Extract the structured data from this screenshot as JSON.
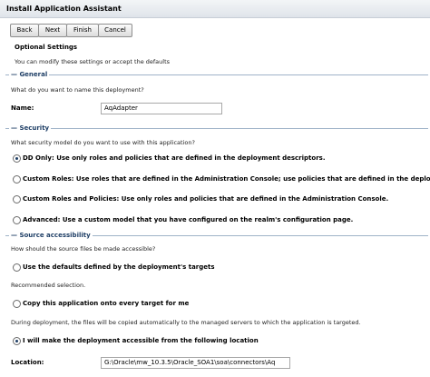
{
  "window": {
    "title": "Install Application Assistant"
  },
  "toolbar": {
    "back": "Back",
    "next": "Next",
    "finish": "Finish",
    "cancel": "Cancel"
  },
  "optional": {
    "title": "Optional Settings",
    "desc": "You can modify these settings or accept the defaults"
  },
  "general": {
    "title": "General",
    "question": "What do you want to name this deployment?",
    "name_label": "Name:",
    "name_value": "AqAdapter"
  },
  "security": {
    "title": "Security",
    "question": "What security model do you want to use with this application?",
    "options": [
      "DD Only: Use only roles and policies that are defined in the deployment descriptors.",
      "Custom Roles: Use roles that are defined in the Administration Console; use policies that are defined in the deployment descripto",
      "Custom Roles and Policies: Use only roles and policies that are defined in the Administration Console.",
      "Advanced: Use a custom model that you have configured on the realm's configuration page."
    ],
    "selected_index": 0
  },
  "source": {
    "title": "Source accessibility",
    "question": "How should the source files be made accessible?",
    "opt1": "Use the defaults defined by the deployment's targets",
    "recommended": "Recommended selection.",
    "opt2": "Copy this application onto every target for me",
    "note": "During deployment, the files will be copied automatically to the managed servers to which the application is targeted.",
    "opt3": "I will make the deployment accessible from the following location",
    "location_label": "Location:",
    "location_value": "G:\\Oracle\\mw_10.3.5\\Oracle_SOA1\\soa\\connectors\\Aq",
    "selected_index": 2
  }
}
